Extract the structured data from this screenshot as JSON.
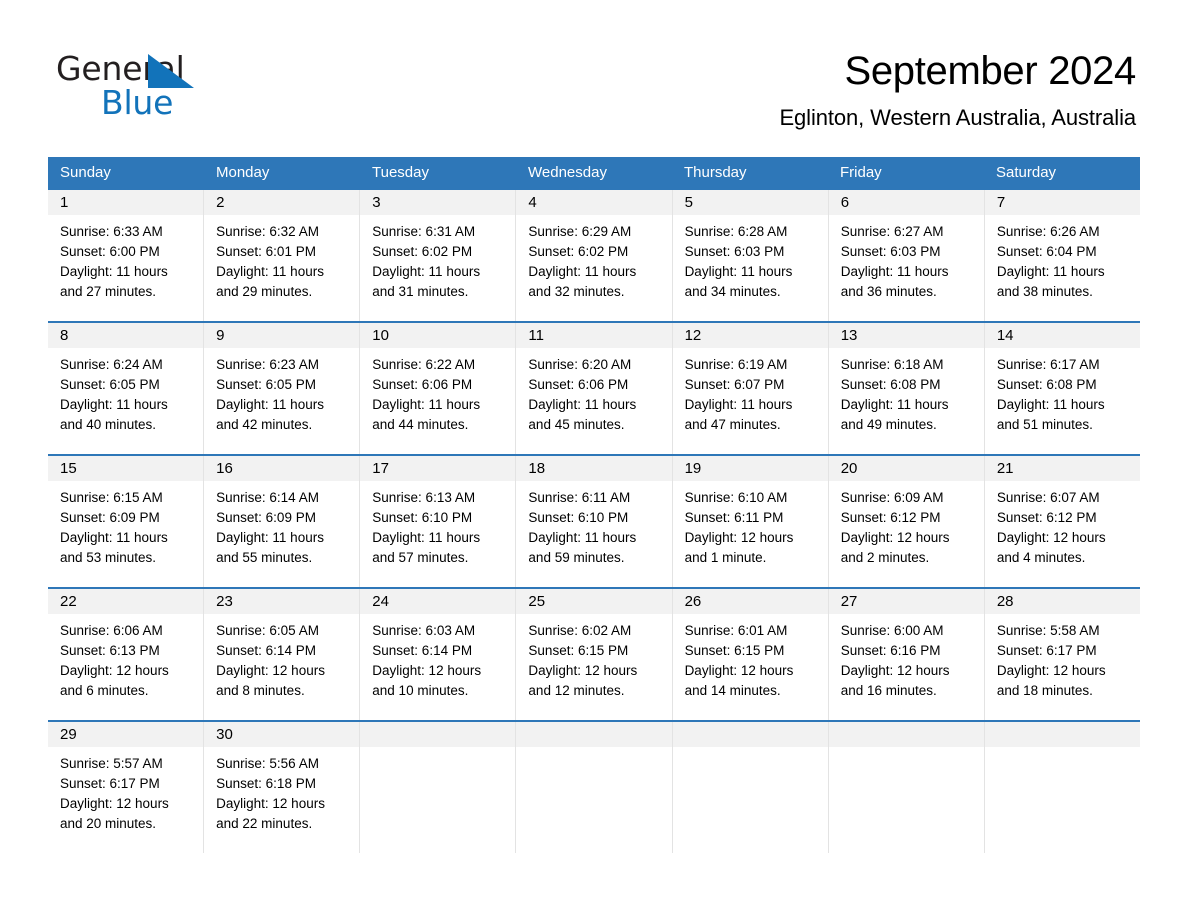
{
  "brand": {
    "name_part1": "General",
    "name_part2": "Blue",
    "accent_color": "#1273ba"
  },
  "header": {
    "month_title": "September 2024",
    "location": "Eglinton, Western Australia, Australia"
  },
  "theme": {
    "header_blue": "#2e77b8",
    "day_band_gray": "#f2f2f2",
    "cell_border": "#e3e3e3"
  },
  "weekdays": [
    "Sunday",
    "Monday",
    "Tuesday",
    "Wednesday",
    "Thursday",
    "Friday",
    "Saturday"
  ],
  "weeks": [
    [
      {
        "day": "1",
        "sunrise": "Sunrise: 6:33 AM",
        "sunset": "Sunset: 6:00 PM",
        "daylight": "Daylight: 11 hours and 27 minutes."
      },
      {
        "day": "2",
        "sunrise": "Sunrise: 6:32 AM",
        "sunset": "Sunset: 6:01 PM",
        "daylight": "Daylight: 11 hours and 29 minutes."
      },
      {
        "day": "3",
        "sunrise": "Sunrise: 6:31 AM",
        "sunset": "Sunset: 6:02 PM",
        "daylight": "Daylight: 11 hours and 31 minutes."
      },
      {
        "day": "4",
        "sunrise": "Sunrise: 6:29 AM",
        "sunset": "Sunset: 6:02 PM",
        "daylight": "Daylight: 11 hours and 32 minutes."
      },
      {
        "day": "5",
        "sunrise": "Sunrise: 6:28 AM",
        "sunset": "Sunset: 6:03 PM",
        "daylight": "Daylight: 11 hours and 34 minutes."
      },
      {
        "day": "6",
        "sunrise": "Sunrise: 6:27 AM",
        "sunset": "Sunset: 6:03 PM",
        "daylight": "Daylight: 11 hours and 36 minutes."
      },
      {
        "day": "7",
        "sunrise": "Sunrise: 6:26 AM",
        "sunset": "Sunset: 6:04 PM",
        "daylight": "Daylight: 11 hours and 38 minutes."
      }
    ],
    [
      {
        "day": "8",
        "sunrise": "Sunrise: 6:24 AM",
        "sunset": "Sunset: 6:05 PM",
        "daylight": "Daylight: 11 hours and 40 minutes."
      },
      {
        "day": "9",
        "sunrise": "Sunrise: 6:23 AM",
        "sunset": "Sunset: 6:05 PM",
        "daylight": "Daylight: 11 hours and 42 minutes."
      },
      {
        "day": "10",
        "sunrise": "Sunrise: 6:22 AM",
        "sunset": "Sunset: 6:06 PM",
        "daylight": "Daylight: 11 hours and 44 minutes."
      },
      {
        "day": "11",
        "sunrise": "Sunrise: 6:20 AM",
        "sunset": "Sunset: 6:06 PM",
        "daylight": "Daylight: 11 hours and 45 minutes."
      },
      {
        "day": "12",
        "sunrise": "Sunrise: 6:19 AM",
        "sunset": "Sunset: 6:07 PM",
        "daylight": "Daylight: 11 hours and 47 minutes."
      },
      {
        "day": "13",
        "sunrise": "Sunrise: 6:18 AM",
        "sunset": "Sunset: 6:08 PM",
        "daylight": "Daylight: 11 hours and 49 minutes."
      },
      {
        "day": "14",
        "sunrise": "Sunrise: 6:17 AM",
        "sunset": "Sunset: 6:08 PM",
        "daylight": "Daylight: 11 hours and 51 minutes."
      }
    ],
    [
      {
        "day": "15",
        "sunrise": "Sunrise: 6:15 AM",
        "sunset": "Sunset: 6:09 PM",
        "daylight": "Daylight: 11 hours and 53 minutes."
      },
      {
        "day": "16",
        "sunrise": "Sunrise: 6:14 AM",
        "sunset": "Sunset: 6:09 PM",
        "daylight": "Daylight: 11 hours and 55 minutes."
      },
      {
        "day": "17",
        "sunrise": "Sunrise: 6:13 AM",
        "sunset": "Sunset: 6:10 PM",
        "daylight": "Daylight: 11 hours and 57 minutes."
      },
      {
        "day": "18",
        "sunrise": "Sunrise: 6:11 AM",
        "sunset": "Sunset: 6:10 PM",
        "daylight": "Daylight: 11 hours and 59 minutes."
      },
      {
        "day": "19",
        "sunrise": "Sunrise: 6:10 AM",
        "sunset": "Sunset: 6:11 PM",
        "daylight": "Daylight: 12 hours and 1 minute."
      },
      {
        "day": "20",
        "sunrise": "Sunrise: 6:09 AM",
        "sunset": "Sunset: 6:12 PM",
        "daylight": "Daylight: 12 hours and 2 minutes."
      },
      {
        "day": "21",
        "sunrise": "Sunrise: 6:07 AM",
        "sunset": "Sunset: 6:12 PM",
        "daylight": "Daylight: 12 hours and 4 minutes."
      }
    ],
    [
      {
        "day": "22",
        "sunrise": "Sunrise: 6:06 AM",
        "sunset": "Sunset: 6:13 PM",
        "daylight": "Daylight: 12 hours and 6 minutes."
      },
      {
        "day": "23",
        "sunrise": "Sunrise: 6:05 AM",
        "sunset": "Sunset: 6:14 PM",
        "daylight": "Daylight: 12 hours and 8 minutes."
      },
      {
        "day": "24",
        "sunrise": "Sunrise: 6:03 AM",
        "sunset": "Sunset: 6:14 PM",
        "daylight": "Daylight: 12 hours and 10 minutes."
      },
      {
        "day": "25",
        "sunrise": "Sunrise: 6:02 AM",
        "sunset": "Sunset: 6:15 PM",
        "daylight": "Daylight: 12 hours and 12 minutes."
      },
      {
        "day": "26",
        "sunrise": "Sunrise: 6:01 AM",
        "sunset": "Sunset: 6:15 PM",
        "daylight": "Daylight: 12 hours and 14 minutes."
      },
      {
        "day": "27",
        "sunrise": "Sunrise: 6:00 AM",
        "sunset": "Sunset: 6:16 PM",
        "daylight": "Daylight: 12 hours and 16 minutes."
      },
      {
        "day": "28",
        "sunrise": "Sunrise: 5:58 AM",
        "sunset": "Sunset: 6:17 PM",
        "daylight": "Daylight: 12 hours and 18 minutes."
      }
    ],
    [
      {
        "day": "29",
        "sunrise": "Sunrise: 5:57 AM",
        "sunset": "Sunset: 6:17 PM",
        "daylight": "Daylight: 12 hours and 20 minutes."
      },
      {
        "day": "30",
        "sunrise": "Sunrise: 5:56 AM",
        "sunset": "Sunset: 6:18 PM",
        "daylight": "Daylight: 12 hours and 22 minutes."
      },
      {
        "day": "",
        "sunrise": "",
        "sunset": "",
        "daylight": ""
      },
      {
        "day": "",
        "sunrise": "",
        "sunset": "",
        "daylight": ""
      },
      {
        "day": "",
        "sunrise": "",
        "sunset": "",
        "daylight": ""
      },
      {
        "day": "",
        "sunrise": "",
        "sunset": "",
        "daylight": ""
      },
      {
        "day": "",
        "sunrise": "",
        "sunset": "",
        "daylight": ""
      }
    ]
  ]
}
